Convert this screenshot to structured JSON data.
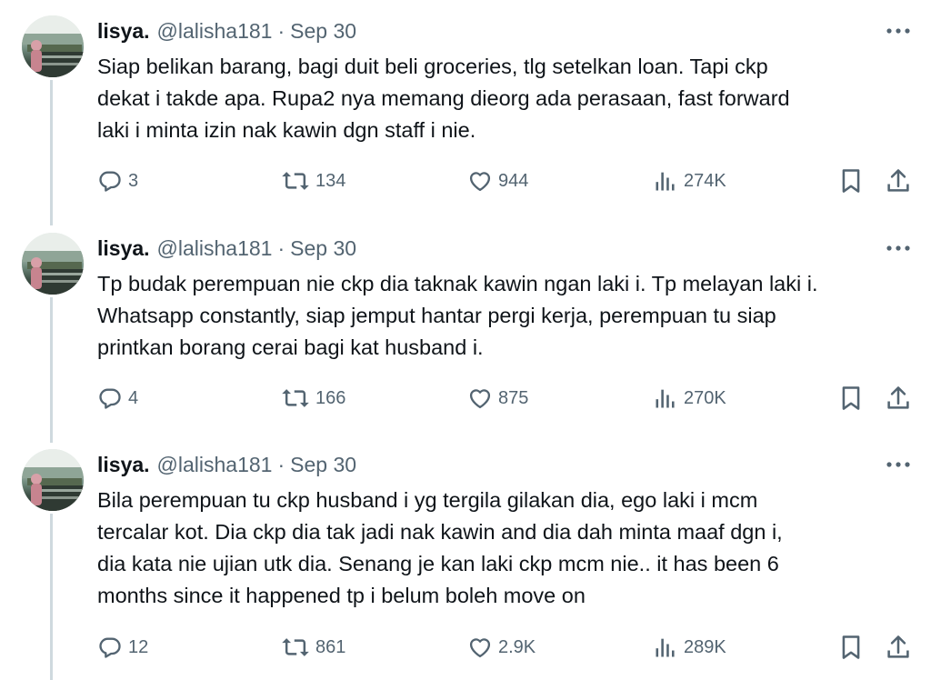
{
  "tweets": [
    {
      "name": "lisya.",
      "handle": "@lalisha181",
      "separator": "·",
      "date": "Sep 30",
      "text": "Siap belikan barang, bagi duit beli groceries, tlg setelkan loan. Tapi ckp\ndekat i takde apa. Rupa2 nya memang dieorg ada perasaan, fast forward\nlaki i minta izin nak kawin dgn staff i nie.",
      "replies": "3",
      "reposts": "134",
      "likes": "944",
      "views": "274K"
    },
    {
      "name": "lisya.",
      "handle": "@lalisha181",
      "separator": "·",
      "date": "Sep 30",
      "text": "Tp budak perempuan nie ckp dia taknak kawin ngan laki i. Tp melayan laki i.\nWhatsapp constantly, siap jemput hantar pergi kerja, perempuan tu siap\nprintkan borang  cerai bagi kat husband i.",
      "replies": "4",
      "reposts": "166",
      "likes": "875",
      "views": "270K"
    },
    {
      "name": "lisya.",
      "handle": "@lalisha181",
      "separator": "·",
      "date": "Sep 30",
      "text": "Bila perempuan tu ckp husband i yg tergila gilakan dia, ego laki i mcm\ntercalar kot. Dia ckp dia tak jadi nak kawin and dia dah minta maaf dgn i,\ndia kata nie ujian utk dia. Senang je kan laki ckp mcm nie.. it has been 6\nmonths since it happened tp i belum boleh move on",
      "replies": "12",
      "reposts": "861",
      "likes": "2.9K",
      "views": "289K"
    }
  ],
  "icons": {
    "reply": "reply-icon",
    "repost": "repost-icon",
    "like": "like-icon",
    "views": "views-icon",
    "bookmark": "bookmark-icon",
    "share": "share-icon",
    "more": "more-icon"
  },
  "colors": {
    "text": "#0f1419",
    "secondary": "#536471",
    "thread_line": "#cfd9de"
  }
}
